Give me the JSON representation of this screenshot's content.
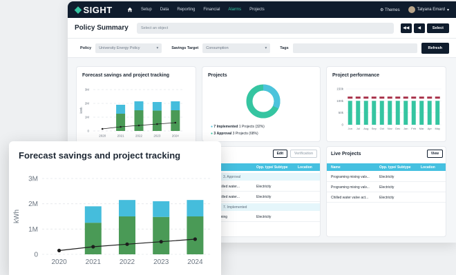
{
  "nav": {
    "logo": "SIGHT",
    "items": [
      {
        "label": "Setup"
      },
      {
        "label": "Data"
      },
      {
        "label": "Reporting"
      },
      {
        "label": "Financial"
      },
      {
        "label": "Alarms"
      },
      {
        "label": "Projects"
      }
    ],
    "active": "Alarms",
    "themes": "Themes",
    "user": "Tatyana Emard"
  },
  "header": {
    "title": "Policy Summary",
    "object_placeholder": "Select an object",
    "select_label": "Select"
  },
  "filters": {
    "policy_label": "Policy",
    "policy_value": "University Energy Policy",
    "target_label": "Savings Target",
    "target_value": "Consumption",
    "tags_label": "Tags",
    "refresh_label": "Refresh"
  },
  "cards": {
    "forecast_title": "Forecast savings and project tracking",
    "projects_title": "Projects",
    "performance_title": "Project performance"
  },
  "projects_donut": {
    "legend": [
      {
        "count": "7",
        "status": "Implemented",
        "detail": "1 Projects (32%)",
        "color": "#4cc3dc"
      },
      {
        "count": "3",
        "status": "Approval",
        "detail": "3 Projects (68%)",
        "color": "#35c5a1"
      }
    ],
    "values": [
      32,
      68
    ]
  },
  "proj_table": {
    "title_partial": "jects",
    "edit_label": "Edit",
    "verification_label": "Verification",
    "columns": [
      "Opp. type/ Subtype",
      "Location"
    ],
    "group1": "3. Approval",
    "group2": "7. Implemented",
    "rows1": [
      {
        "name": "d chilled water...",
        "type": "Electricity"
      },
      {
        "name": "d chilled water...",
        "type": "Electricity"
      }
    ],
    "rows2": [
      {
        "name": "graming",
        "type": "Electricity"
      }
    ]
  },
  "live_projects": {
    "title": "Live Projects",
    "view_label": "View",
    "columns": [
      "Name",
      "Opp. type/ Subtype",
      "Location"
    ],
    "rows": [
      {
        "name": "Programing mixing valv...",
        "type": "Electricity"
      },
      {
        "name": "Programing mixing valv...",
        "type": "Electricity"
      },
      {
        "name": "Chilled water valve act...",
        "type": "Electricity"
      }
    ]
  },
  "colors": {
    "navy": "#0f1c2d",
    "teal": "#35c5a1",
    "bar_green": "#4a9a56",
    "bar_cyan": "#45bddc",
    "perf_red": "#a8324a"
  },
  "chart_data": [
    {
      "type": "bar",
      "title": "Forecast savings and project tracking",
      "ylabel": "kWh",
      "categories": [
        "2020",
        "2021",
        "2022",
        "2023",
        "2024"
      ],
      "y_ticks": [
        "0",
        "1M",
        "2M",
        "3M"
      ],
      "ylim": [
        0,
        3000000
      ],
      "series": [
        {
          "values": [
            0,
            1250000,
            1500000,
            1480000,
            1500000
          ],
          "color": "#4a9a56"
        },
        {
          "values": [
            0,
            650000,
            650000,
            620000,
            650000
          ],
          "color": "#45bddc"
        }
      ],
      "line": [
        150000,
        300000,
        400000,
        500000,
        600000
      ]
    },
    {
      "type": "bar",
      "title": "Project performance",
      "y_ticks": [
        "0",
        "50k",
        "100k",
        "150k"
      ],
      "ylim": [
        0,
        150000
      ],
      "categories": [
        "Jun",
        "Jul",
        "Aug",
        "Sep",
        "Oct",
        "Nov",
        "Dec",
        "Jan",
        "Feb",
        "Mar",
        "Apr",
        "May"
      ],
      "series": [
        {
          "values": [
            100000,
            100000,
            100000,
            100000,
            100000,
            100000,
            100000,
            100000,
            100000,
            100000,
            100000,
            100000
          ],
          "color": "#35c5a1"
        },
        {
          "values": [
            115000,
            115000,
            115000,
            115000,
            115000,
            115000,
            115000,
            115000,
            115000,
            115000,
            115000,
            115000
          ],
          "color": "#a8324a"
        }
      ]
    }
  ]
}
